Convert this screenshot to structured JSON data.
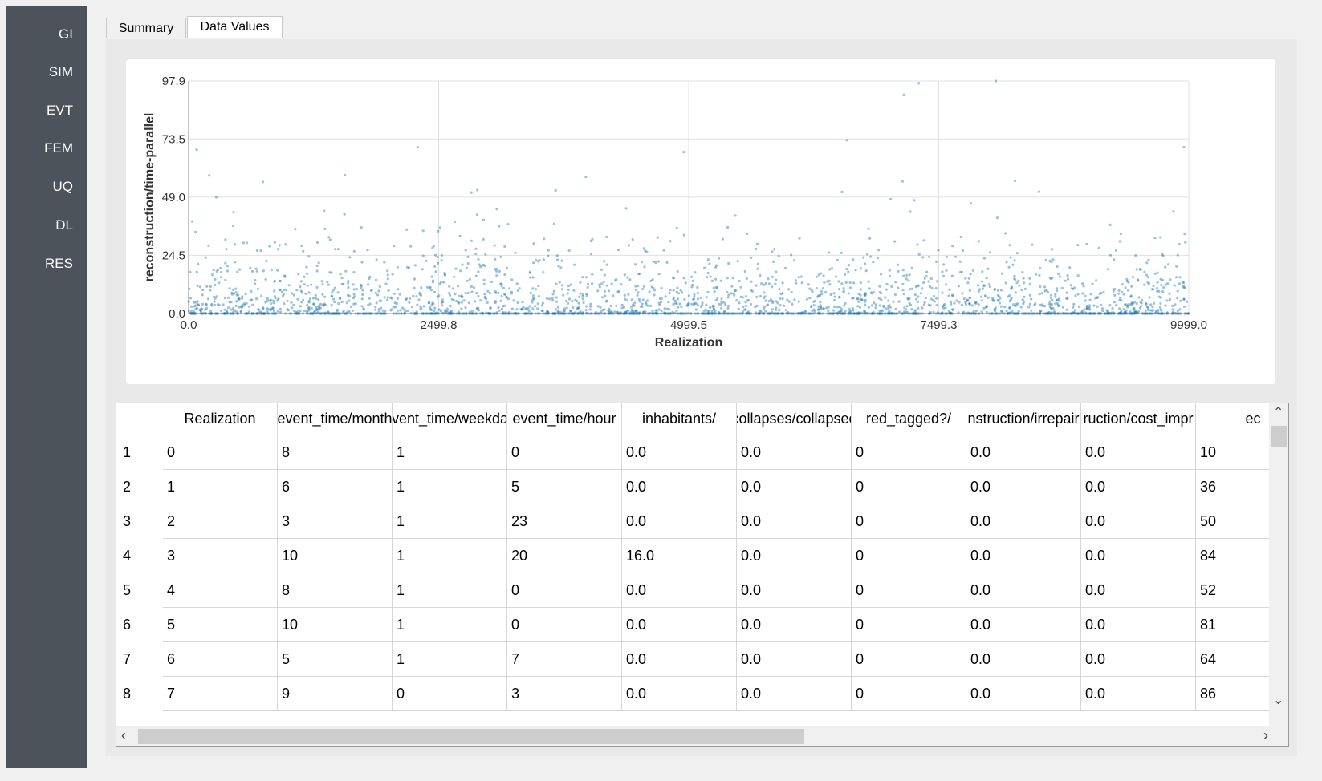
{
  "sidebar": {
    "items": [
      {
        "label": "GI"
      },
      {
        "label": "SIM"
      },
      {
        "label": "EVT"
      },
      {
        "label": "FEM"
      },
      {
        "label": "UQ"
      },
      {
        "label": "DL"
      },
      {
        "label": "RES"
      }
    ],
    "background": "#4d535a"
  },
  "tabs": [
    {
      "label": "Summary",
      "selected": false
    },
    {
      "label": "Data Values",
      "selected": true
    }
  ],
  "chart_data": {
    "type": "scatter",
    "xlabel": "Realization",
    "ylabel": "reconstruction/time-parallel",
    "xlim": [
      0.0,
      9999.0
    ],
    "ylim": [
      0.0,
      97.9
    ],
    "xticks": [
      "0.0",
      "2499.8",
      "4999.5",
      "7499.3",
      "9999.0"
    ],
    "yticks": [
      "0.0",
      "24.5",
      "49.0",
      "73.5",
      "97.9"
    ],
    "grid": true,
    "point_color": "#1f77b4",
    "n_points": 10000,
    "notable_points": [
      {
        "x": 80,
        "y": 69
      },
      {
        "x": 2290,
        "y": 70
      },
      {
        "x": 4950,
        "y": 68
      },
      {
        "x": 6580,
        "y": 73
      },
      {
        "x": 7150,
        "y": 92
      },
      {
        "x": 7300,
        "y": 97
      },
      {
        "x": 8070,
        "y": 97.9
      },
      {
        "x": 9950,
        "y": 70
      }
    ]
  },
  "table": {
    "columns": [
      "Realization",
      "event_time/month",
      "event_time/weekday",
      "event_time/hour",
      "inhabitants/",
      "collapses/collapsed",
      "red_tagged?/",
      "reconstruction/irreparable",
      "reconstruction/cost_impractical",
      "reconstruction/time-parallel"
    ],
    "header_display": [
      "Realization",
      "event_time/month",
      "event_time/weekday",
      "event_time/hour",
      "inhabitants/",
      "collapses/collapsec",
      "red_tagged?/",
      "nstruction/irrepair",
      "ruction/cost_impr",
      "ec"
    ],
    "row_numbers": [
      "1",
      "2",
      "3",
      "4",
      "5",
      "6",
      "7",
      "8"
    ],
    "rows": [
      [
        "0",
        "8",
        "1",
        "0",
        "0.0",
        "0.0",
        "0",
        "0.0",
        "0.0",
        "10"
      ],
      [
        "1",
        "6",
        "1",
        "5",
        "0.0",
        "0.0",
        "0",
        "0.0",
        "0.0",
        "36"
      ],
      [
        "2",
        "3",
        "1",
        "23",
        "0.0",
        "0.0",
        "0",
        "0.0",
        "0.0",
        "50"
      ],
      [
        "3",
        "10",
        "1",
        "20",
        "16.0",
        "0.0",
        "0",
        "0.0",
        "0.0",
        "84"
      ],
      [
        "4",
        "8",
        "1",
        "0",
        "0.0",
        "0.0",
        "0",
        "0.0",
        "0.0",
        "52"
      ],
      [
        "5",
        "10",
        "1",
        "0",
        "0.0",
        "0.0",
        "0",
        "0.0",
        "0.0",
        "81"
      ],
      [
        "6",
        "5",
        "1",
        "7",
        "0.0",
        "0.0",
        "0",
        "0.0",
        "0.0",
        "64"
      ],
      [
        "7",
        "9",
        "0",
        "3",
        "0.0",
        "0.0",
        "0",
        "0.0",
        "0.0",
        "86"
      ]
    ]
  }
}
